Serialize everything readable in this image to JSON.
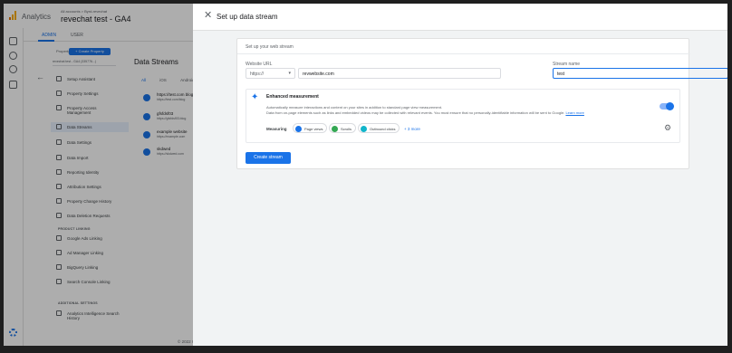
{
  "app": {
    "title": "Analytics",
    "account_line": "All accounts > Byrd-revechat",
    "property_name": "revechat test - GA4"
  },
  "admin_tabs": [
    {
      "label": "ADMIN",
      "active": true
    },
    {
      "label": "USER",
      "active": false
    }
  ],
  "property": {
    "label": "Property",
    "create_button": "+ Create Property",
    "selected": "revechat test - GA4 (335776...)"
  },
  "menu": {
    "items": [
      {
        "label": "Setup Assistant",
        "selected": false
      },
      {
        "label": "Property Settings",
        "selected": false
      },
      {
        "label": "Property Access Management",
        "selected": false
      },
      {
        "label": "Data Streams",
        "selected": true
      },
      {
        "label": "Data Settings",
        "selected": false
      },
      {
        "label": "Data Import",
        "selected": false
      },
      {
        "label": "Reporting Identity",
        "selected": false
      },
      {
        "label": "Attribution Settings",
        "selected": false
      },
      {
        "label": "Property Change History",
        "selected": false
      },
      {
        "label": "Data Deletion Requests",
        "selected": false
      }
    ],
    "product_linking_header": "PRODUCT LINKING",
    "product_linking": [
      {
        "label": "Google Ads Linking"
      },
      {
        "label": "Ad Manager Linking"
      },
      {
        "label": "BigQuery Linking"
      },
      {
        "label": "Search Console Linking"
      }
    ],
    "additional_header": "ADDITIONAL SETTINGS",
    "additional": [
      {
        "label": "Analytics Intelligence Search History"
      }
    ]
  },
  "data_streams": {
    "title": "Data Streams",
    "filters": [
      "All",
      "iOS",
      "Android"
    ],
    "rows": [
      {
        "name": "https://test.com blog",
        "url": "https://test.com/blog"
      },
      {
        "name": "gfsfdsf03",
        "url": "https://gfsfdsf03.blog"
      },
      {
        "name": "example website",
        "url": "https://example.com"
      },
      {
        "name": "skdwed",
        "url": "https://skdwed.com"
      }
    ],
    "copyright": "© 2022 G"
  },
  "panel": {
    "title": "Set up data stream",
    "subtitle": "Set up your web stream",
    "website_url_label": "Website URL",
    "protocol": "https://",
    "website_url": "revwebsite.com",
    "stream_name_label": "Stream name",
    "stream_name": "test",
    "enhanced": {
      "title": "Enhanced measurement",
      "desc_line1": "Automatically measure interactions and content on your sites in addition to standard page view measurement.",
      "desc_line2": "Data from on-page elements such as links and embedded videos may be collected with relevant events. You must ensure that no personally-identifiable information will be sent to Google.",
      "learn_more": "Learn more",
      "enabled": true,
      "measuring_label": "Measuring",
      "chips": [
        {
          "label": "Page views",
          "color": "#1a73e8"
        },
        {
          "label": "Scrolls",
          "color": "#34a853"
        },
        {
          "label": "Outbound clicks",
          "color": "#12b5cb"
        }
      ],
      "more": "+ 3 more"
    },
    "create_button": "Create stream"
  },
  "colors": {
    "accent": "#1a73e8",
    "overlay": "rgba(0,0,0,0.32)"
  }
}
